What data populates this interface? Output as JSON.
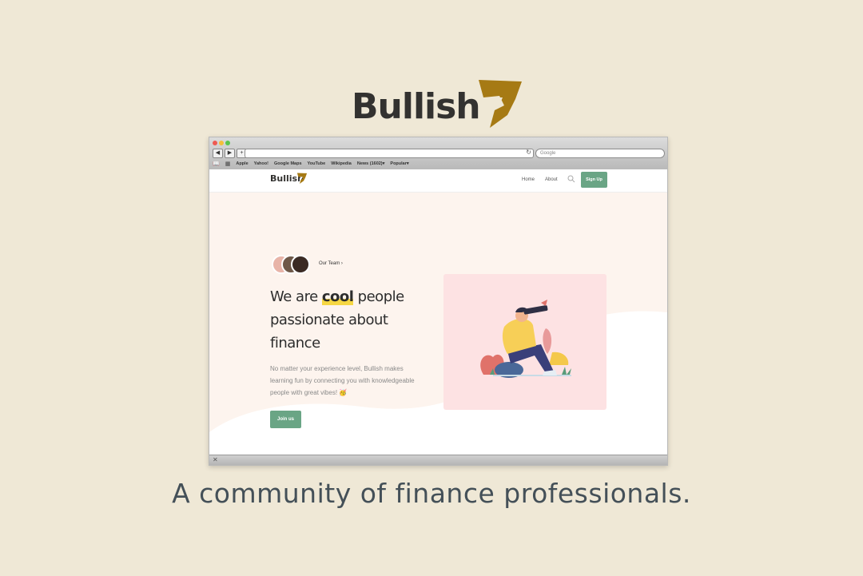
{
  "brand": {
    "name": "Bullish",
    "mark_icon": "bull-horn-icon",
    "color": "#a67a14"
  },
  "browser": {
    "search_placeholder": "Google",
    "bookmarks": [
      "Apple",
      "Yahoo!",
      "Google Maps",
      "YouTube",
      "Wikipedia",
      "News (1602)▾",
      "Popular▾"
    ]
  },
  "site": {
    "logo": "Bullish",
    "nav": {
      "home": "Home",
      "about": "About",
      "signup": "Sign Up"
    },
    "hero": {
      "team_link": "Our Team ›",
      "headline_pre": "We are ",
      "headline_highlight": "cool",
      "headline_post": " people passionate about finance",
      "description": "No matter your experience level, Bullish makes learning fun by connecting you with knowledgeable people with great vibes! 🥳",
      "cta": "Join us"
    },
    "accent": "#6aa585",
    "highlight": "#f6d743",
    "card_bg": "#fde2e3"
  },
  "tagline": "A community of finance professionals."
}
